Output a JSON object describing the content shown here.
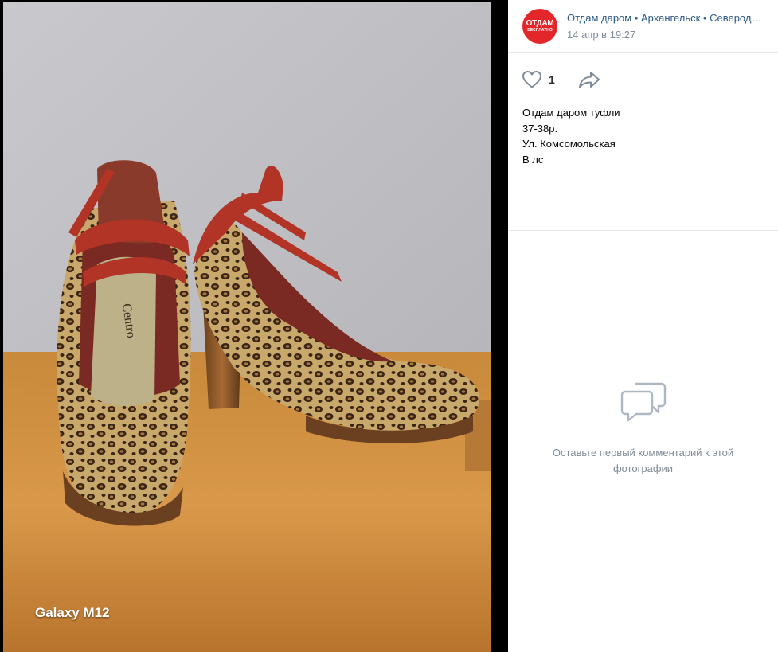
{
  "photo": {
    "watermark": "Galaxy M12",
    "insole_brand": "Centro"
  },
  "post": {
    "avatar_text_1": "ОТДАМ",
    "avatar_text_2": "БЕСПЛАТНО",
    "group_name": "Отдам даром • Архангельск • Северодвинск",
    "date": "14 апр в 19:27",
    "like_count": "1",
    "text_lines": [
      "Отдам даром туфли",
      "37-38р.",
      "Ул. Комсомольская",
      "В лс"
    ]
  },
  "comments": {
    "empty_message": "Оставьте первый комментарий к этой фотографии"
  },
  "colors": {
    "link": "#2a5885",
    "muted": "#818c99",
    "avatar_bg": "#e3262a",
    "divider": "#e7e8ec"
  }
}
